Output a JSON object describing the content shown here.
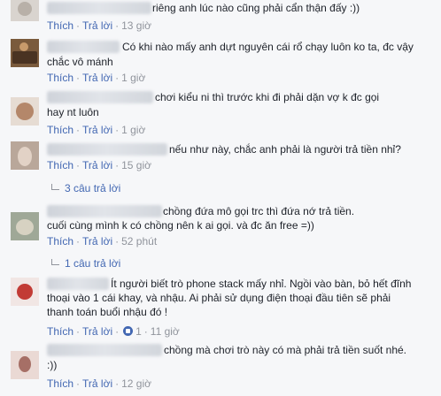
{
  "actions": {
    "like": "Thích",
    "reply": "Trả lời",
    "sep": "·"
  },
  "comments": [
    {
      "lines": [
        "riêng anh lúc nào cũng phải cẩn thận đấy :))"
      ],
      "time": "13 giờ"
    },
    {
      "lines": [
        "Có khi nào mấy anh dựt nguyên cái rổ chạy luôn ko ta, đc vậy",
        "chắc vô mánh"
      ],
      "time": "1 giờ"
    },
    {
      "lines": [
        "chơi kiểu ni thì trước khi đi phải dặn vợ k đc gọi",
        "hay nt luôn"
      ],
      "time": "1 giờ"
    },
    {
      "lines": [
        "nếu như này, chắc anh phải là người trả tiền nhỉ?"
      ],
      "time": "15 giờ",
      "replies": "3 câu trả lời"
    },
    {
      "lines": [
        "chồng đứa mô gọi trc thì đứa nớ trả tiền.",
        "cuối cùng mình k có chồng nên k ai gọi. và đc ăn free =))"
      ],
      "time": "52 phút",
      "replies": "1 câu trả lời"
    },
    {
      "lines": [
        "Ít người biết trò phone stack mấy nhỉ. Ngồi vào bàn, bỏ hết đĩnh",
        "thoại vào 1 cái khay, và nhậu. Ai phải sử dụng điện thoại đầu tiên sẽ phải",
        "thanh toán buổi nhậu đó !"
      ],
      "time": "11 giờ",
      "likes": "1"
    },
    {
      "lines": [
        "chồng mà chơi trò này có mà phải trả tiền suốt nhé.",
        ":))"
      ],
      "time": "12 giờ"
    }
  ]
}
